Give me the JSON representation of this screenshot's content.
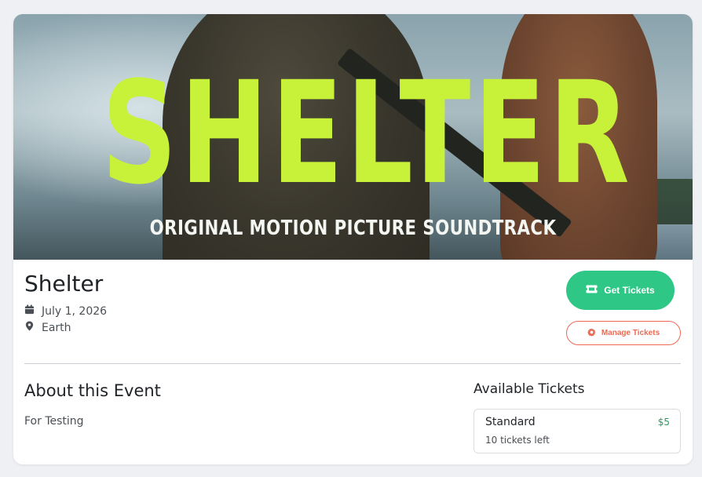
{
  "banner": {
    "title": "SHELTER",
    "subtitle": "ORIGINAL MOTION PICTURE SOUNDTRACK"
  },
  "event": {
    "title": "Shelter",
    "date": "July 1, 2026",
    "location": "Earth"
  },
  "actions": {
    "get_tickets_label": "Get Tickets",
    "manage_tickets_label": "Manage Tickets"
  },
  "about": {
    "heading": "About this Event",
    "description": "For Testing"
  },
  "tickets": {
    "heading": "Available Tickets",
    "items": [
      {
        "name": "Standard",
        "price": "$5",
        "remaining": "10 tickets left"
      }
    ]
  },
  "icons": {
    "date": "calendar-icon",
    "location": "map-pin-icon",
    "get_tickets": "ticket-icon",
    "manage_tickets": "gear-icon"
  },
  "colors": {
    "accent_green": "#2ec786",
    "accent_coral": "#ec6a53",
    "banner_title": "#c8f23a",
    "price_green": "#2a9d5c"
  }
}
